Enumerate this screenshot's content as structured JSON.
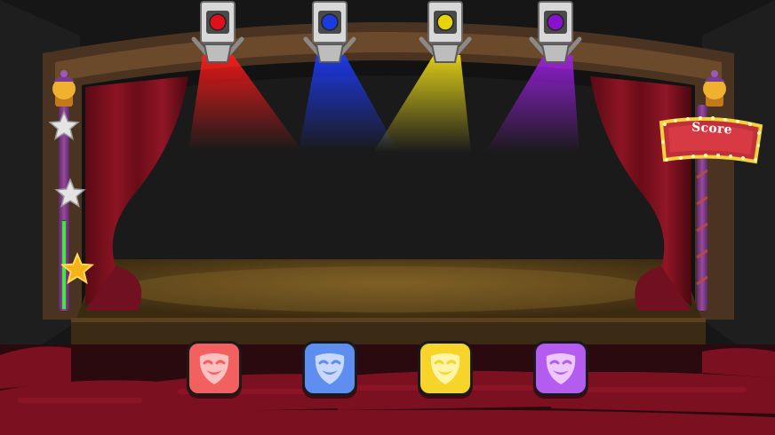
{
  "scoreboard": {
    "label": "Score"
  },
  "spotlights": [
    {
      "name": "red",
      "color": "#e0101a",
      "beam": "#ff1a1a"
    },
    {
      "name": "blue",
      "color": "#1a3be0",
      "beam": "#1e3cff"
    },
    {
      "name": "yellow",
      "color": "#e8d20a",
      "beam": "#f4e21a"
    },
    {
      "name": "purple",
      "color": "#8a10d0",
      "beam": "#a020e8"
    }
  ],
  "mask_buttons": [
    {
      "name": "red",
      "color": "#f26060",
      "face": "#ffc0c0"
    },
    {
      "name": "blue",
      "color": "#5e8ef0",
      "face": "#c8d8ff"
    },
    {
      "name": "yellow",
      "color": "#f6d42a",
      "face": "#fff4a8"
    },
    {
      "name": "purple",
      "color": "#b45cf0",
      "face": "#ecc8ff"
    }
  ],
  "progress": {
    "stars_total": 3,
    "stars_earned": 1,
    "fill_fraction": 0.38
  }
}
